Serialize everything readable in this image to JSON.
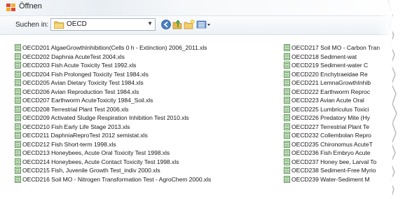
{
  "window": {
    "title": "Öffnen"
  },
  "toolbar": {
    "look_in_label": "Suchen in:",
    "look_in_value": "OECD"
  },
  "files_col1": [
    "OECD201 AlgaeGrowthInhibition(Cells 0 h - Extinction) 2006_2011.xls",
    "OECD202 Daphnia AcuteTest 2004.xls",
    "OECD203 Fish Acute Toxicity Test 1992.xls",
    "OECD204 Fish Prolonged Toxicity Test 1984.xls",
    "OECD205 Avian Dietary Toxicity Test 1984.xls",
    "OECD206 Avian Reproduction Test 1984.xls",
    "OECD207 Earthworm AcuteToxicity 1984_Soil.xls",
    "OECD208 Terrestrial Plant Test 2006.xls",
    "OECD209 Activated Sludge Respiration Inhibition Test 2010.xls",
    "OECD210 Fish Early Life Stage 2013.xls",
    "OECD211 DaphniaReproTest 2012 semistat.xls",
    "OECD212 Fish Short-term 1998.xls",
    "OECD213 Honeybees, Acute Oral Toxicity Test 1998.xls",
    "OECD214 Honeybees, Acute Contact Toxicity Test 1998.xls",
    "OECD215 Fish, Juvenile Growth Test_indiv 2000.xls",
    "OECD216 Soil MO - Nitrogen Transformation Test - AgroChem 2000.xls"
  ],
  "files_col2": [
    "OECD217 Soil MO - Carbon Tran",
    "OECD218 Sediment-wat",
    "OECD219 Sediment-water C",
    "OECD220 Enchytraeidae Re",
    "OECD221 LemnaGrowthInhib",
    "OECD222 Earthworm Reproc",
    "OECD223 Avian Acute Oral",
    "OECD225 Lumbriculus Toxici",
    "OECD226 Predatory Mite (Hy",
    "OECD227 Terrestrial Plant Te",
    "OECD232 Collembolan Repro",
    "OECD235 Chironomus AcuteT",
    "OECD236 Fish Embryo Acute",
    "OECD237 Honey bee, Larval To",
    "OECD238 Sediment-Free Myrio",
    "OECD239 Water-Sediment M"
  ]
}
